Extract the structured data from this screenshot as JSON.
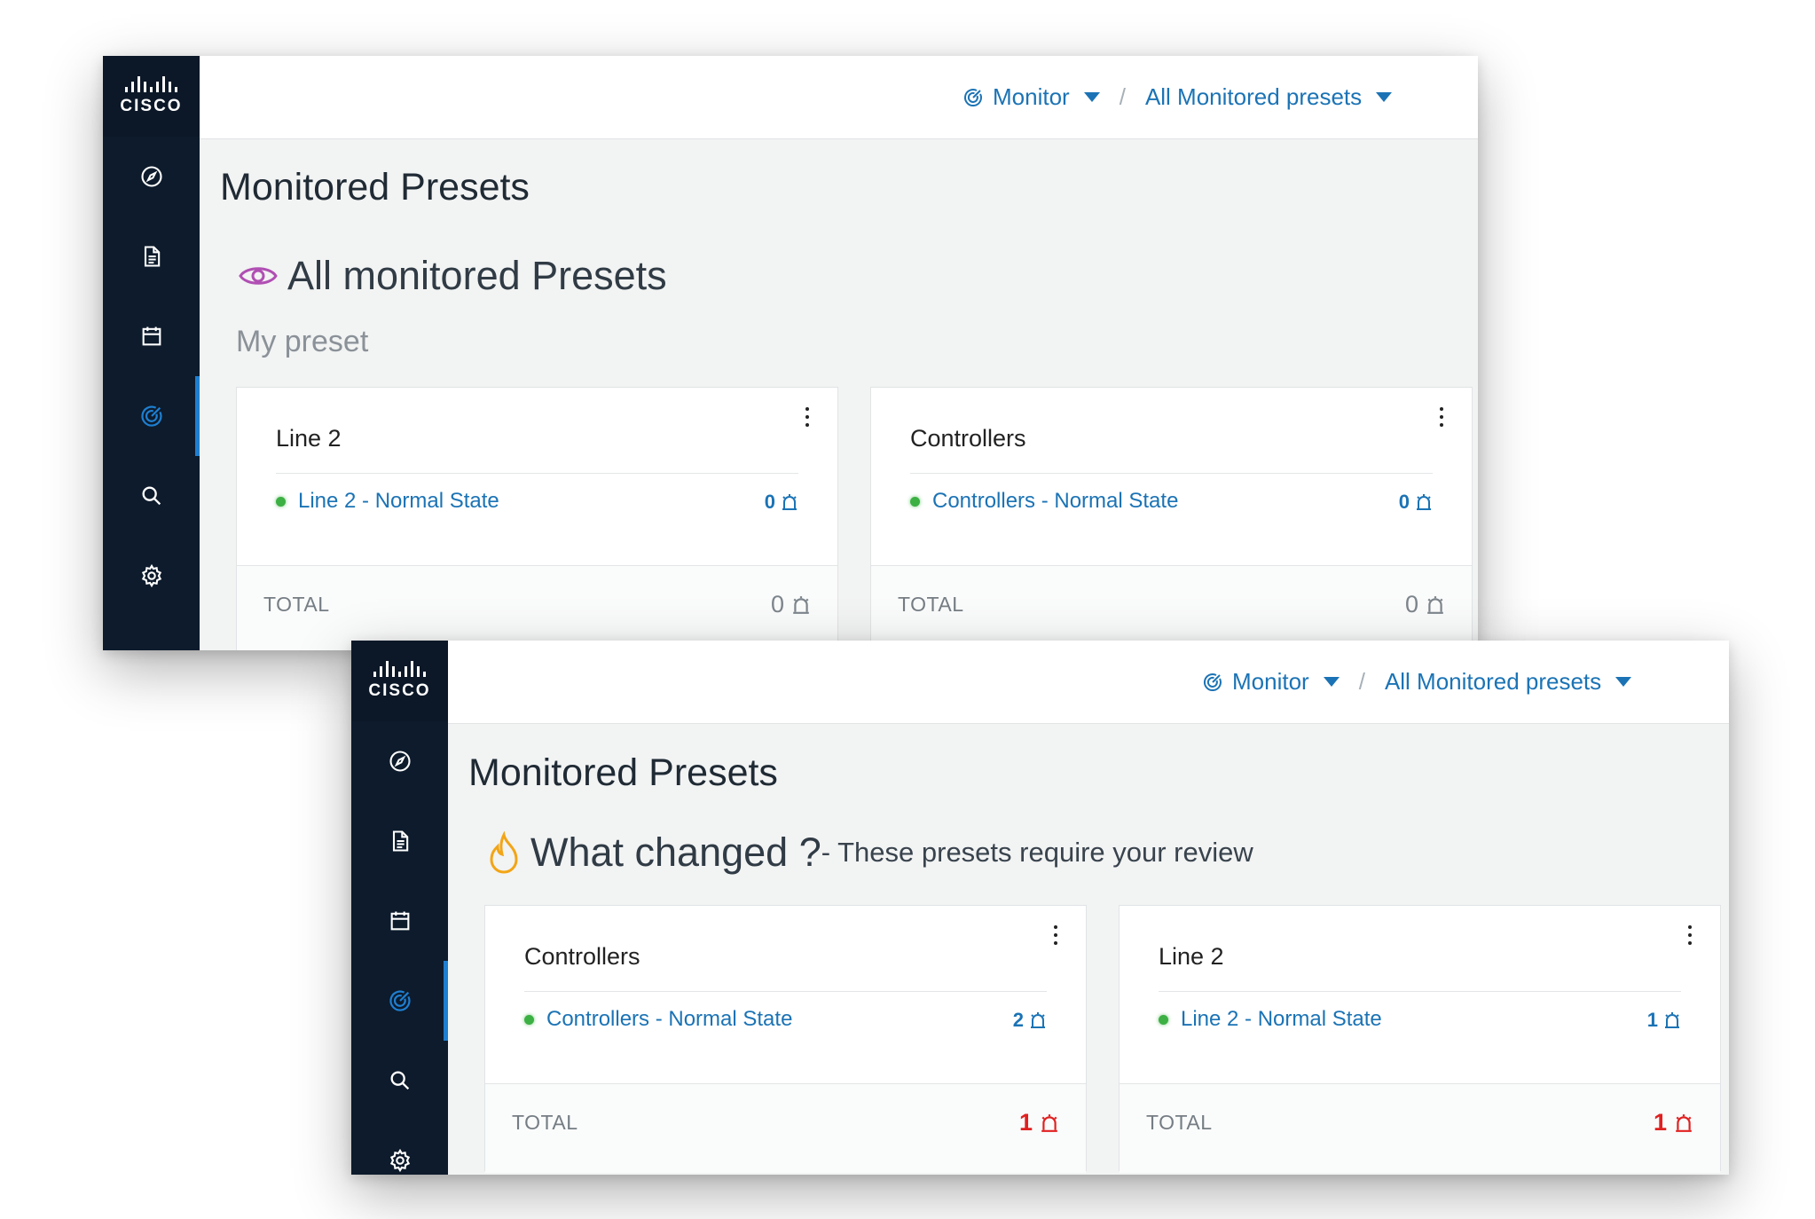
{
  "windows": [
    {
      "brand": "CISCO",
      "breadcrumb": {
        "first": "Monitor",
        "second": "All Monitored presets",
        "separator": "/"
      },
      "page_title": "Monitored Presets",
      "section": {
        "icon": "eye-icon",
        "title": "All monitored Presets",
        "note": ""
      },
      "subheading": "My preset",
      "cards": [
        {
          "name": "Line 2",
          "state": "Line 2 - Normal State",
          "state_count": "0",
          "total_label": "TOTAL",
          "total": "0",
          "alert": false
        },
        {
          "name": "Controllers",
          "state": "Controllers - Normal State",
          "state_count": "0",
          "total_label": "TOTAL",
          "total": "0",
          "alert": false
        }
      ]
    },
    {
      "brand": "CISCO",
      "breadcrumb": {
        "first": "Monitor",
        "second": "All Monitored presets",
        "separator": "/"
      },
      "page_title": "Monitored Presets",
      "section": {
        "icon": "flame-icon",
        "title": "What changed ?",
        "note": " - These presets require your review"
      },
      "subheading": "",
      "cards": [
        {
          "name": "Controllers",
          "state": "Controllers - Normal State",
          "state_count": "2",
          "total_label": "TOTAL",
          "total": "1",
          "alert": true
        },
        {
          "name": "Line 2",
          "state": "Line 2 - Normal State",
          "state_count": "1",
          "total_label": "TOTAL",
          "total": "1",
          "alert": true
        }
      ]
    }
  ],
  "sidebar_icons": [
    "compass-icon",
    "document-icon",
    "calendar-icon",
    "monitor-target-icon",
    "search-icon",
    "gear-icon"
  ],
  "colors": {
    "sidebar": "#0d1b2c",
    "link": "#1b73b5",
    "active": "#1e7fd1",
    "ok": "#3cb043",
    "alert": "#e02020",
    "eye": "#b04fb3",
    "flame": "#f2a516"
  }
}
